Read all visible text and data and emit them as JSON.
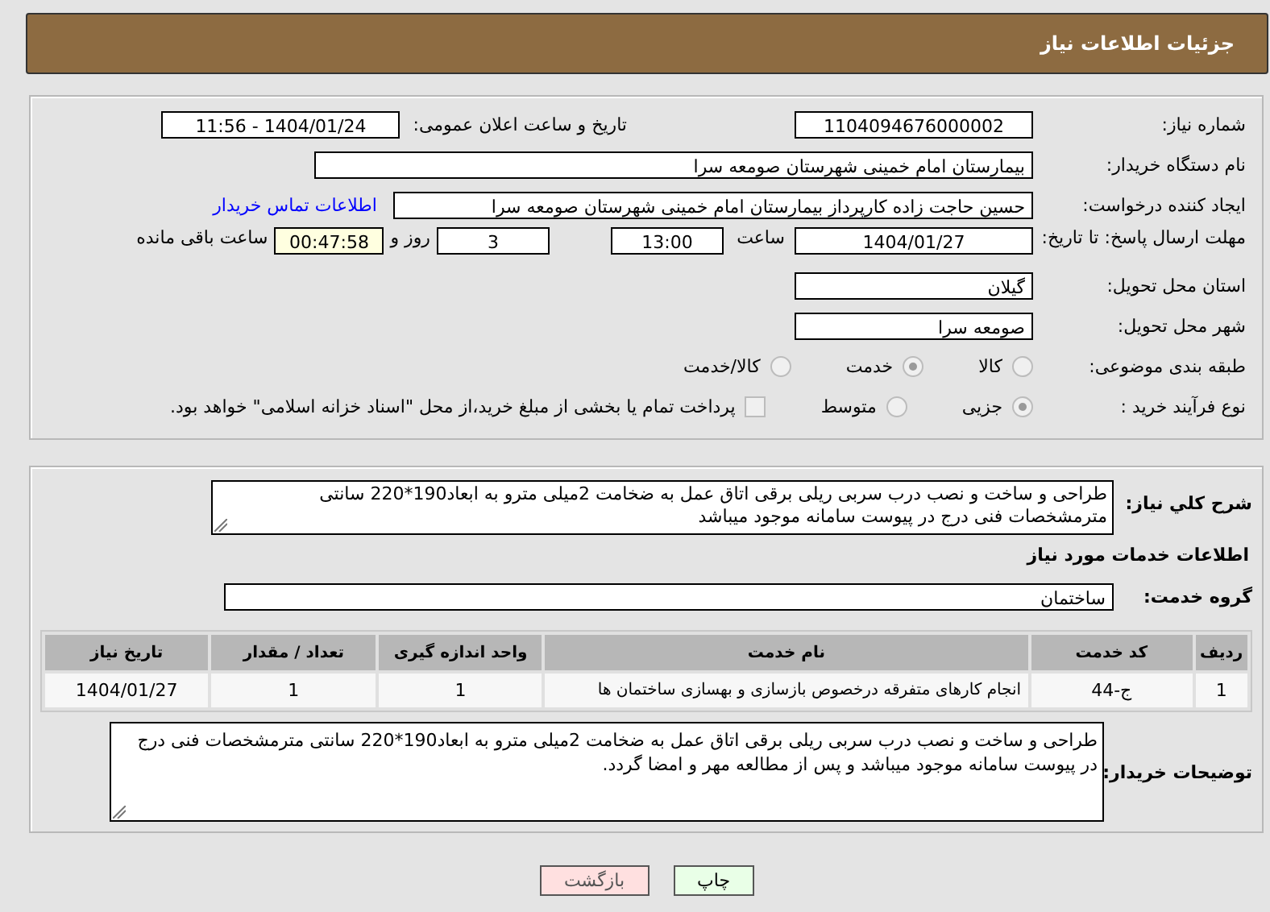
{
  "header": {
    "title": "جزئیات اطلاعات نیاز"
  },
  "need_number": {
    "label": "شماره نیاز:",
    "value": "1104094676000002"
  },
  "announce_datetime": {
    "label": "تاریخ و ساعت اعلان عمومی:",
    "value": "1404/01/24 - 11:56"
  },
  "buyer_org": {
    "label": "نام دستگاه خریدار:",
    "value": "بیمارستان امام خمینی شهرستان صومعه سرا"
  },
  "requester": {
    "label": "ایجاد کننده درخواست:",
    "value": "حسین حاجت زاده کارپرداز بیمارستان امام خمینی شهرستان صومعه سرا",
    "contact_link": "اطلاعات تماس خریدار"
  },
  "deadline": {
    "label": "مهلت ارسال پاسخ: تا تاریخ:",
    "date": "1404/01/27",
    "time_label": "ساعت",
    "time": "13:00",
    "days": "3",
    "days_label": "روز و",
    "remaining": "00:47:58",
    "remaining_label": "ساعت باقی مانده"
  },
  "province": {
    "label": "استان محل تحویل:",
    "value": "گیلان"
  },
  "city": {
    "label": "شهر محل تحویل:",
    "value": "صومعه سرا"
  },
  "category": {
    "label": "طبقه بندی موضوعی:",
    "options": [
      {
        "label": "کالا",
        "selected": false
      },
      {
        "label": "خدمت",
        "selected": true
      },
      {
        "label": "کالا/خدمت",
        "selected": false
      }
    ]
  },
  "purchase_type": {
    "label": "نوع فرآیند خرید :",
    "options": [
      {
        "label": "جزیی",
        "selected": true
      },
      {
        "label": "متوسط",
        "selected": false
      }
    ],
    "treasury_payment": {
      "label": "پرداخت تمام یا بخشی از مبلغ خرید،از محل \"اسناد خزانه اسلامی\" خواهد بود.",
      "checked": false
    }
  },
  "summary": {
    "label": "شرح کلي نياز:",
    "value": "طراحی و ساخت و نصب درب سربی ریلی برقی اتاق عمل به ضخامت 2میلی مترو به ابعاد190*220 سانتی مترمشخصات فنی درج در پیوست سامانه موجود میباشد"
  },
  "services_heading": "اطلاعات خدمات مورد نیاز",
  "service_group": {
    "label": "گروه خدمت:",
    "value": "ساختمان"
  },
  "table": {
    "columns": [
      "ردیف",
      "کد خدمت",
      "نام خدمت",
      "واحد اندازه گیری",
      "تعداد / مقدار",
      "تاریخ نیاز"
    ],
    "rows": [
      [
        "1",
        "ج-44",
        "انجام کارهای متفرقه درخصوص بازسازی و بهسازی ساختمان ها",
        "1",
        "1",
        "1404/01/27"
      ]
    ]
  },
  "buyer_notes": {
    "label": "توضیحات خریدار:",
    "value": "طراحی و ساخت و نصب درب سربی ریلی برقی اتاق عمل به ضخامت 2میلی مترو به ابعاد190*220 سانتی مترمشخصات فنی درج در پیوست سامانه موجود میباشد و پس از مطالعه مهر و امضا گردد."
  },
  "buttons": [
    {
      "label": "چاپ",
      "kind": "print"
    },
    {
      "label": "بازگشت",
      "kind": "back"
    }
  ]
}
